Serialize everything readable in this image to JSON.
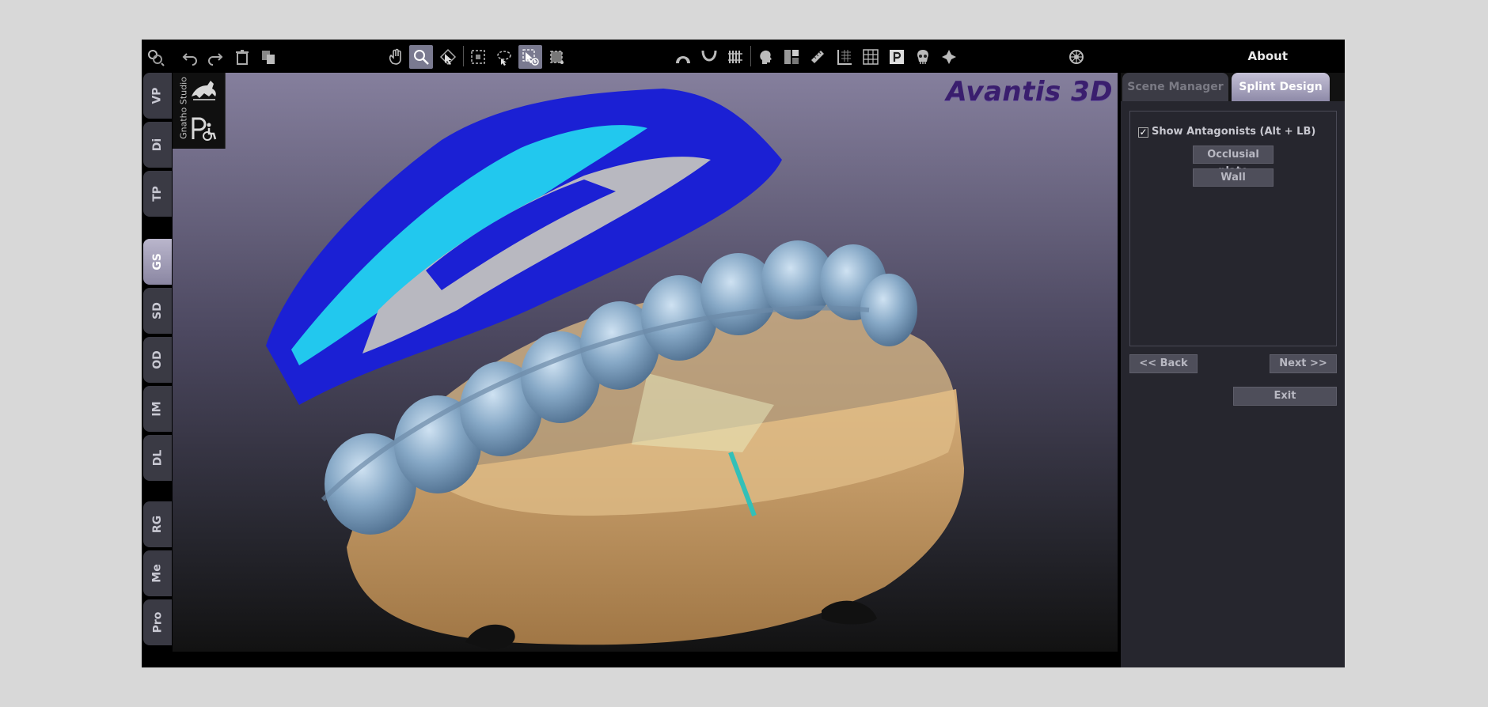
{
  "window": {
    "about_label": "About"
  },
  "toolbar": {
    "icons": [
      {
        "name": "app-menu-icon"
      },
      {
        "name": "undo-icon"
      },
      {
        "name": "redo-icon"
      },
      {
        "name": "delete-icon"
      },
      {
        "name": "copy-icon"
      },
      {
        "name": "pan-hand-icon"
      },
      {
        "name": "zoom-icon",
        "active": true
      },
      {
        "name": "rotate-select-icon"
      },
      {
        "name": "box-select-icon"
      },
      {
        "name": "lasso-select-icon"
      },
      {
        "name": "pointer-add-icon",
        "active": true
      },
      {
        "name": "crop-select-icon"
      },
      {
        "name": "upper-arch-icon"
      },
      {
        "name": "lower-arch-icon"
      },
      {
        "name": "teeth-row-icon"
      },
      {
        "name": "head-profile-icon"
      },
      {
        "name": "layout-split-icon"
      },
      {
        "name": "ruler-icon"
      },
      {
        "name": "grid-axis-icon"
      },
      {
        "name": "grid-icon"
      },
      {
        "name": "p-marker-icon"
      },
      {
        "name": "skull-icon"
      },
      {
        "name": "pin-icon"
      },
      {
        "name": "settings-wheel-icon"
      }
    ]
  },
  "left_tabs": [
    {
      "label": "VP",
      "active": false
    },
    {
      "label": "Di",
      "active": false
    },
    {
      "label": "TP",
      "active": false
    },
    {
      "label": "GS",
      "active": true
    },
    {
      "label": "SD",
      "active": false
    },
    {
      "label": "OD",
      "active": false
    },
    {
      "label": "IM",
      "active": false
    },
    {
      "label": "DL",
      "active": false
    },
    {
      "label": "RG",
      "active": false
    },
    {
      "label": "Me",
      "active": false
    },
    {
      "label": "Pro",
      "active": false
    }
  ],
  "viewport": {
    "gnatho_label": "Gnatho Studio",
    "logo_text": "Avantis 3D",
    "colors": {
      "background_top": "#857f9d",
      "background_bottom": "#121212",
      "antagonist_blue": "#1b20d4",
      "antagonist_cyan": "#22c8ee",
      "splint_gray_blue": "#7fa0bd",
      "model_tan": "#c69a60"
    }
  },
  "right_panel": {
    "tabs": [
      {
        "label": "Scene Manager",
        "active": false
      },
      {
        "label": "Splint Design",
        "active": true
      }
    ],
    "show_antagonists": {
      "checked": true,
      "label": "Show Antagonists (Alt + LB)"
    },
    "occlusal_plate_label": "Occlusial plate",
    "wall_label": "Wall",
    "back_label": "<<   Back",
    "next_label": "Next   >>",
    "exit_label": "Exit"
  }
}
